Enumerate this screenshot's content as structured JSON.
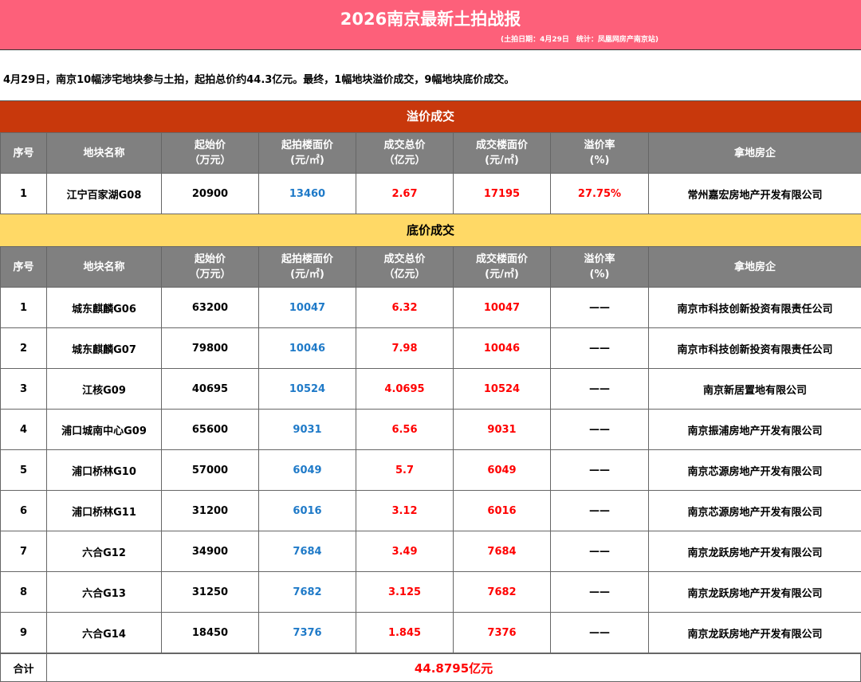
{
  "title": "2026南京最新土拍战报",
  "subtitle": "(土拍日期：4月29日　统计：凤凰网房产南京站)",
  "intro": "4月29日，南京10幅涉宅地块参与土拍，起拍总价约44.3亿元。最终，1幅地块溢价成交，9幅地块底价成交。",
  "headers": [
    "序号",
    "地块名称",
    "起始价\n（万元）",
    "起拍楼面价\n(元/㎡)",
    "成交总价\n（亿元）",
    "成交楼面价\n(元/㎡)",
    "溢价率\n(%)",
    "拿地房企"
  ],
  "sections": [
    {
      "title": "溢价成交",
      "rows": [
        [
          "1",
          "江宁百家湖G08",
          "20900",
          "13460",
          "2.67",
          "17195",
          "27.75%",
          "常州嘉宏房地产开发有限公司"
        ]
      ]
    },
    {
      "title": "底价成交",
      "rows": [
        [
          "1",
          "城东麒麟G06",
          "63200",
          "10047",
          "6.32",
          "10047",
          "——",
          "南京市科技创新投资有限责任公司"
        ],
        [
          "2",
          "城东麒麟G07",
          "79800",
          "10046",
          "7.98",
          "10046",
          "——",
          "南京市科技创新投资有限责任公司"
        ],
        [
          "3",
          "江核G09",
          "40695",
          "10524",
          "4.0695",
          "10524",
          "——",
          "南京新居置地有限公司"
        ],
        [
          "4",
          "浦口城南中心G09",
          "65600",
          "9031",
          "6.56",
          "9031",
          "——",
          "南京振浦房地产开发有限公司"
        ],
        [
          "5",
          "浦口桥林G10",
          "57000",
          "6049",
          "5.7",
          "6049",
          "——",
          "南京芯源房地产开发有限公司"
        ],
        [
          "6",
          "浦口桥林G11",
          "31200",
          "6016",
          "3.12",
          "6016",
          "——",
          "南京芯源房地产开发有限公司"
        ],
        [
          "7",
          "六合G12",
          "34900",
          "7684",
          "3.49",
          "7684",
          "——",
          "南京龙跃房地产开发有限公司"
        ],
        [
          "8",
          "六合G13",
          "31250",
          "7682",
          "3.125",
          "7682",
          "——",
          "南京龙跃房地产开发有限公司"
        ],
        [
          "9",
          "六合G14",
          "18450",
          "7376",
          "1.845",
          "7376",
          "——",
          "南京龙跃房地产开发有限公司"
        ]
      ]
    }
  ],
  "total_label": "合计",
  "total_value": "44.8795亿元"
}
